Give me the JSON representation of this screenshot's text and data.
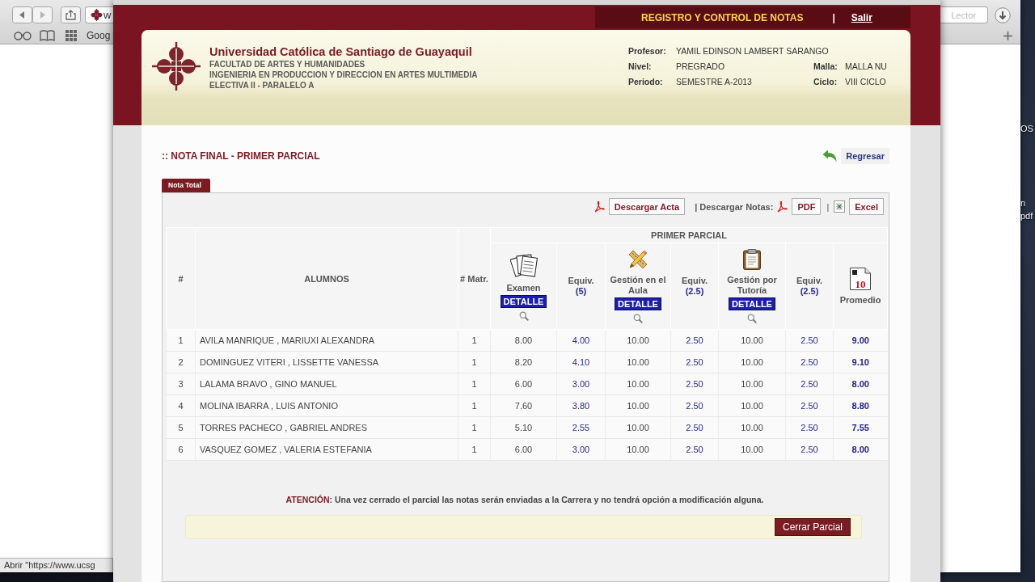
{
  "browser": {
    "tab_text": "w",
    "bookmark": "Goog",
    "reader_button": "Lector",
    "status_text": "Abrir \"https://www.ucsg"
  },
  "desktop_labels": [
    "OS",
    "n",
    "pdf"
  ],
  "top_bar": {
    "title": "REGISTRO Y CONTROL DE NOTAS",
    "separator": "|",
    "logout": "Salir"
  },
  "header": {
    "university": "Universidad Católica de Santiago de Guayaquil",
    "lines": [
      "FACULTAD DE ARTES Y HUMANIDADES",
      "INGENIERIA EN PRODUCCION Y DIRECCION EN ARTES MULTIMEDIA",
      "ELECTIVA II - PARALELO A"
    ],
    "info": [
      [
        {
          "label": "Profesor:",
          "value": "YAMIL EDINSON LAMBERT SARANGO"
        }
      ],
      [
        {
          "label": "Nivel:",
          "value": "PREGRADO"
        },
        {
          "label": "Malla:",
          "value": "MALLA NU"
        }
      ],
      [
        {
          "label": "Periodo:",
          "value": "SEMESTRE A-2013"
        },
        {
          "label": "Ciclo:",
          "value": "VIII CICLO"
        }
      ]
    ]
  },
  "page": {
    "title": ":: NOTA FINAL - PRIMER PARCIAL",
    "back_link": "Regresar"
  },
  "tabs": [
    {
      "label": "Nota Total",
      "selected": true
    }
  ],
  "toolbar": {
    "acta_button": "Descargar Acta",
    "notes_label": "| Descargar Notas:",
    "pdf_button": "PDF",
    "separator": "|",
    "excel_button": "Excel"
  },
  "table": {
    "group_header": "PRIMER PARCIAL",
    "columns": [
      {
        "kind": "index",
        "label": "#"
      },
      {
        "kind": "name",
        "label": "ALUMNOS"
      },
      {
        "kind": "index",
        "label": "# Matr."
      },
      {
        "kind": "activity",
        "label": "Examen",
        "button": "DETALLE"
      },
      {
        "kind": "equiv",
        "label": "Equiv.",
        "weight": "(5)"
      },
      {
        "kind": "activity",
        "label": "Gestión en el Aula",
        "button": "DETALLE"
      },
      {
        "kind": "equiv",
        "label": "Equiv.",
        "weight": "(2.5)"
      },
      {
        "kind": "activity",
        "label": "Gestión por Tutoría",
        "button": "DETALLE"
      },
      {
        "kind": "equiv",
        "label": "Equiv.",
        "weight": "(2.5)"
      },
      {
        "kind": "average",
        "label": "Promedio",
        "icon_text": "10"
      }
    ],
    "rows": [
      [
        "1",
        "AVILA MANRIQUE , MARIUXI ALEXANDRA",
        "1",
        "8.00",
        "4.00",
        "10.00",
        "2.50",
        "10.00",
        "2.50",
        "9.00"
      ],
      [
        "2",
        "DOMINGUEZ VITERI , LISSETTE VANESSA",
        "1",
        "8.20",
        "4.10",
        "10.00",
        "2.50",
        "10.00",
        "2.50",
        "9.10"
      ],
      [
        "3",
        "LALAMA BRAVO , GINO MANUEL",
        "1",
        "6.00",
        "3.00",
        "10.00",
        "2.50",
        "10.00",
        "2.50",
        "8.00"
      ],
      [
        "4",
        "MOLINA IBARRA , LUIS ANTONIO",
        "1",
        "7.60",
        "3.80",
        "10.00",
        "2.50",
        "10.00",
        "2.50",
        "8.80"
      ],
      [
        "5",
        "TORRES PACHECO , GABRIEL ANDRES",
        "1",
        "5.10",
        "2.55",
        "10.00",
        "2.50",
        "10.00",
        "2.50",
        "7.55"
      ],
      [
        "6",
        "VASQUEZ GOMEZ , VALERIA ESTEFANIA",
        "1",
        "6.00",
        "3.00",
        "10.00",
        "2.50",
        "10.00",
        "2.50",
        "8.00"
      ]
    ]
  },
  "notice": {
    "label": "ATENCIÓN:",
    "text": "Una vez cerrado el parcial las notas serán enviadas a la Carrera y no tendrá opción a modificación alguna."
  },
  "close_button": "Cerrar Parcial"
}
